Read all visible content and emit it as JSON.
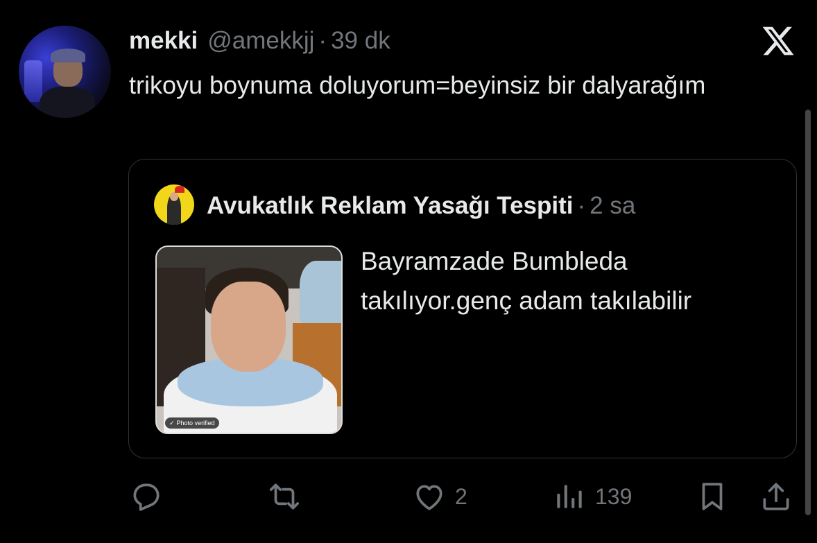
{
  "tweet": {
    "author_name": "mekki",
    "author_handle": "@amekkjj",
    "separator": "·",
    "time": "39 dk",
    "text": "trikoyu boynuma doluyorum=beyinsiz bir dalyarağım"
  },
  "quoted": {
    "author_name": "Avukatlık Reklam Yasağı Tespiti",
    "separator": "·",
    "time": "2 sa",
    "text": "Bayramzade Bumbleda takılıyor.genç adam takılabilir",
    "photo_badge": "Photo verified"
  },
  "actions": {
    "replies": "",
    "reposts": "",
    "likes": "2",
    "views": "139"
  },
  "icons": {
    "logo": "x-logo-icon",
    "reply": "reply-icon",
    "repost": "repost-icon",
    "like": "heart-icon",
    "views": "views-icon",
    "bookmark": "bookmark-icon",
    "share": "share-icon"
  },
  "colors": {
    "background": "#000000",
    "text": "#e7e9ea",
    "muted": "#71767b",
    "border": "#2f3336"
  }
}
